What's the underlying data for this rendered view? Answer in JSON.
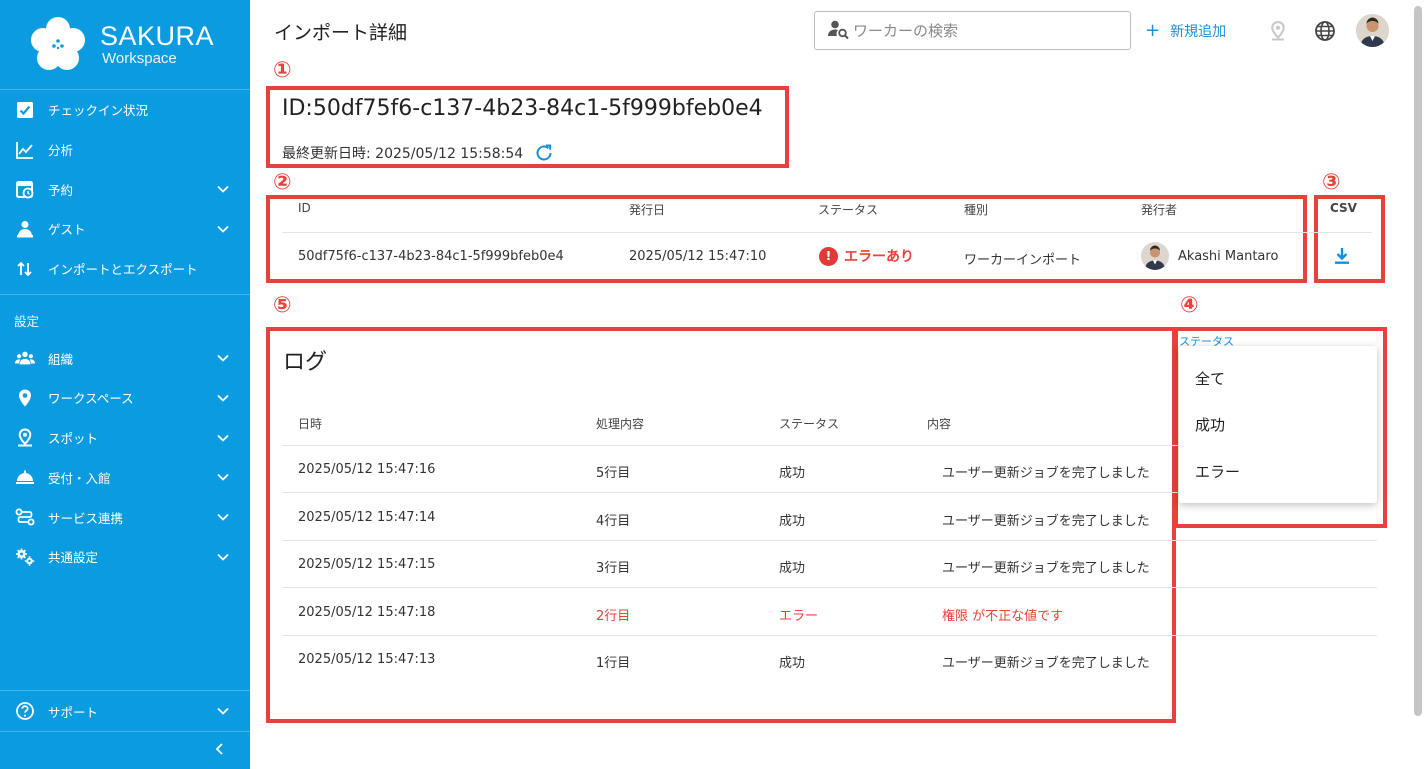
{
  "sidebar": {
    "brand": {
      "name": "SAKURA",
      "sub": "Workspace"
    },
    "items": [
      {
        "label": "チェックイン状況",
        "icon": "checkbox-icon",
        "expand": false
      },
      {
        "label": "分析",
        "icon": "chart-line-icon",
        "expand": false
      },
      {
        "label": "予約",
        "icon": "calendar-icon",
        "expand": true
      },
      {
        "label": "ゲスト",
        "icon": "guest-icon",
        "expand": true
      },
      {
        "label": "インポートとエクスポート",
        "icon": "import-export-icon",
        "expand": false
      }
    ],
    "settings_label": "設定",
    "settings_items": [
      {
        "label": "組織",
        "icon": "people-icon",
        "expand": true
      },
      {
        "label": "ワークスペース",
        "icon": "location-pin-icon",
        "expand": true
      },
      {
        "label": "スポット",
        "icon": "spot-pin-icon",
        "expand": true
      },
      {
        "label": "受付・入館",
        "icon": "reception-bell-icon",
        "expand": true
      },
      {
        "label": "サービス連携",
        "icon": "integration-icon",
        "expand": true
      },
      {
        "label": "共通設定",
        "icon": "gears-icon",
        "expand": true
      }
    ],
    "support_label": "サポート"
  },
  "header": {
    "title": "インポート詳細",
    "search_placeholder": "ワーカーの検索",
    "add_label": "新規追加"
  },
  "markers": {
    "m1": "①",
    "m2": "②",
    "m3": "③",
    "m4": "④",
    "m5": "⑤"
  },
  "import": {
    "id_title": "ID:50df75f6-c137-4b23-84c1-5f999bfeb0e4",
    "updated": "最終更新日時: 2025/05/12 15:58:54"
  },
  "summary_table": {
    "headers": {
      "id": "ID",
      "date": "発行日",
      "status": "ステータス",
      "type": "種別",
      "issuer": "発行者",
      "csv": "CSV"
    },
    "row": {
      "id": "50df75f6-c137-4b23-84c1-5f999bfeb0e4",
      "date": "2025/05/12 15:47:10",
      "status": "エラーあり",
      "type": "ワーカーインポート",
      "issuer": "Akashi Mantaro"
    }
  },
  "log": {
    "title": "ログ",
    "headers": {
      "datetime": "日時",
      "process": "処理内容",
      "status": "ステータス",
      "content": "内容"
    },
    "rows": [
      {
        "datetime": "2025/05/12 15:47:16",
        "process": "5行目",
        "status": "成功",
        "content": "ユーザー更新ジョブを完了しました",
        "error": false
      },
      {
        "datetime": "2025/05/12 15:47:14",
        "process": "4行目",
        "status": "成功",
        "content": "ユーザー更新ジョブを完了しました",
        "error": false
      },
      {
        "datetime": "2025/05/12 15:47:15",
        "process": "3行目",
        "status": "成功",
        "content": "ユーザー更新ジョブを完了しました",
        "error": false
      },
      {
        "datetime": "2025/05/12 15:47:18",
        "process": "2行目",
        "status": "エラー",
        "content": "権限 が不正な値です",
        "error": true
      },
      {
        "datetime": "2025/05/12 15:47:13",
        "process": "1行目",
        "status": "成功",
        "content": "ユーザー更新ジョブを完了しました",
        "error": false
      }
    ]
  },
  "status_filter": {
    "label": "ステータス",
    "options": [
      "全て",
      "成功",
      "エラー"
    ]
  },
  "colors": {
    "sidebar": "#0a9be0",
    "accent": "#1a8fd8",
    "error": "#e8403a",
    "annotation": "#e8403a"
  }
}
